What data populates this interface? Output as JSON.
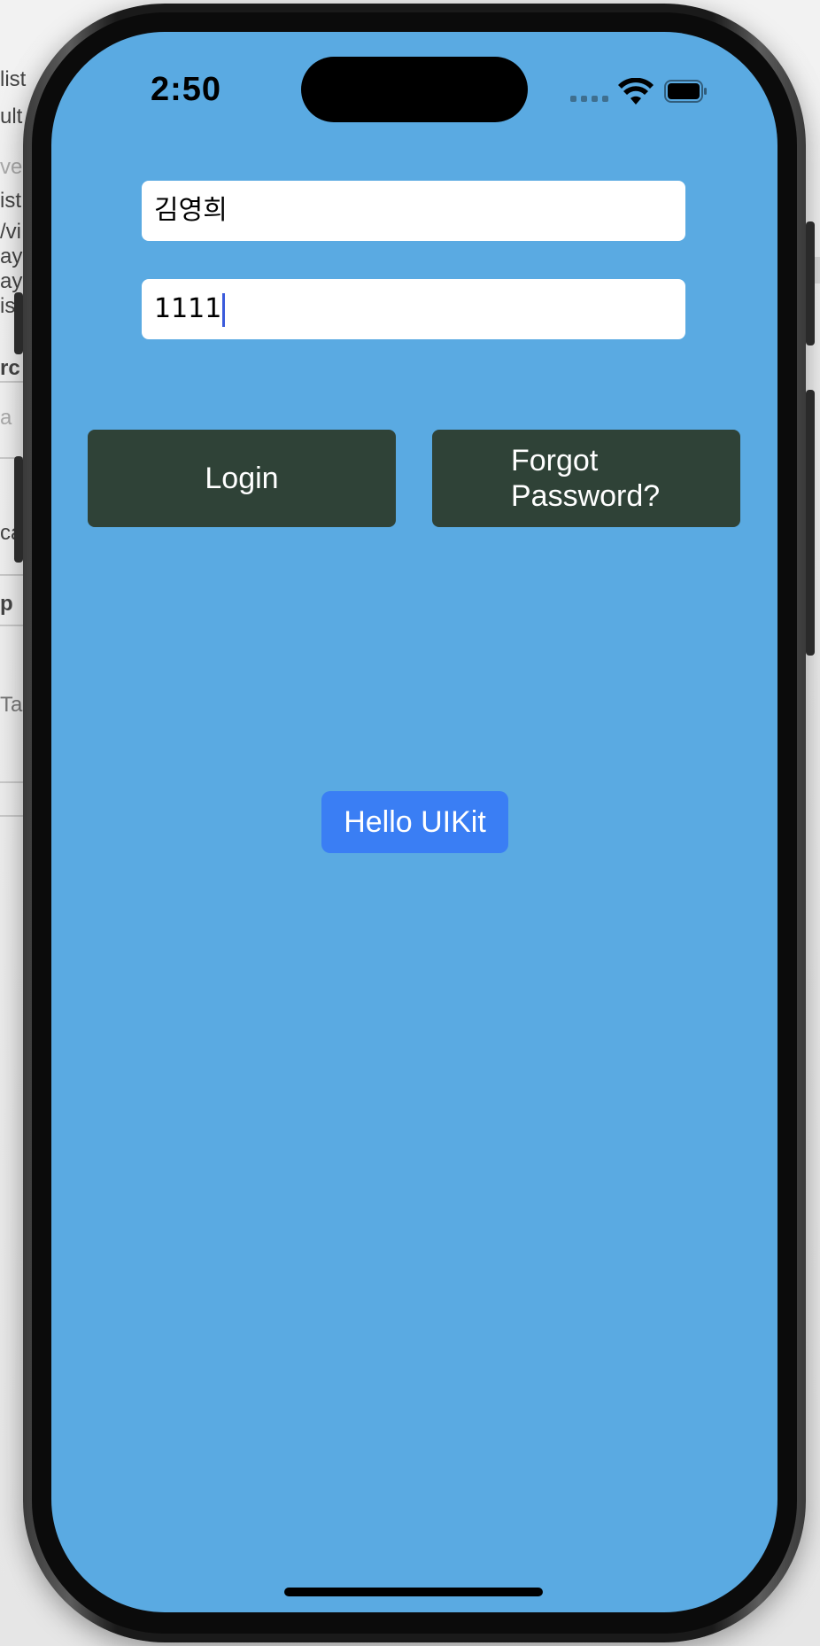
{
  "status_bar": {
    "time": "2:50",
    "signal_icon": "cellular-signal-icon",
    "wifi_icon": "wifi-icon",
    "battery_icon": "battery-icon"
  },
  "form": {
    "username_value": "김영희",
    "password_value": "1111"
  },
  "buttons": {
    "login_label": "Login",
    "forgot_label": "Forgot Password?",
    "hello_label": "Hello UIKit"
  },
  "colors": {
    "screen_background": "#5aaae2",
    "dark_button": "#2f4237",
    "accent_button": "#3a7ef4"
  },
  "backdrop": {
    "fragments": [
      "list",
      "ult",
      "ve",
      "ist",
      "/vi",
      "ayc",
      "ayc",
      "is",
      "rc",
      "a",
      "cal",
      "p",
      "Ta"
    ]
  }
}
